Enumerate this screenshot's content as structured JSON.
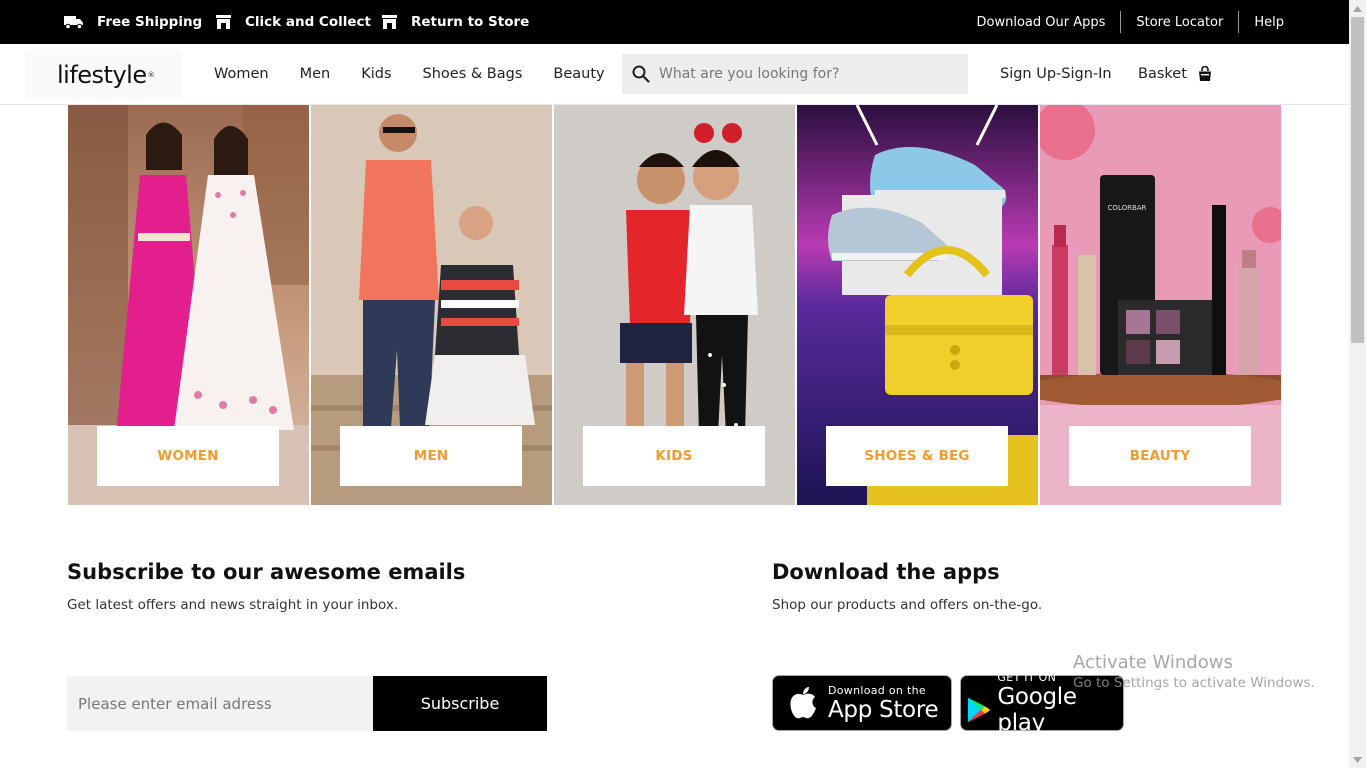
{
  "topbar": {
    "free_shipping": "Free Shipping",
    "click_collect": "Click and Collect",
    "return_store": "Return to Store",
    "download_apps": "Download Our Apps",
    "store_locator": "Store Locator",
    "help": "Help"
  },
  "header": {
    "logo": "lifestyle",
    "nav": [
      "Women",
      "Men",
      "Kids",
      "Shoes & Bags",
      "Beauty"
    ],
    "search_placeholder": "What are you looking for?",
    "account": "Sign Up-Sign-In",
    "basket": "Basket"
  },
  "tiles": [
    "WOMEN",
    "MEN",
    "KIDS",
    "SHOES & BEG",
    "BEAUTY"
  ],
  "subscribe": {
    "title": "Subscribe to our awesome emails",
    "subtitle": "Get latest offers and news straight in your inbox.",
    "email_placeholder": "Please enter email adress",
    "button": "Subscribe"
  },
  "apps": {
    "title": "Download the apps",
    "subtitle": "Shop our products and offers on-the-go.",
    "apple_small": "Download on the",
    "apple_big": "App Store",
    "google_small": "GET IT ON",
    "google_big": "Google play"
  },
  "watermark": {
    "line1": "Activate Windows",
    "line2": "Go to Settings to activate Windows."
  },
  "colors": {
    "topbar_bg": "#000000",
    "tile_label": "#f39c2d",
    "search_bg": "#ededed"
  }
}
